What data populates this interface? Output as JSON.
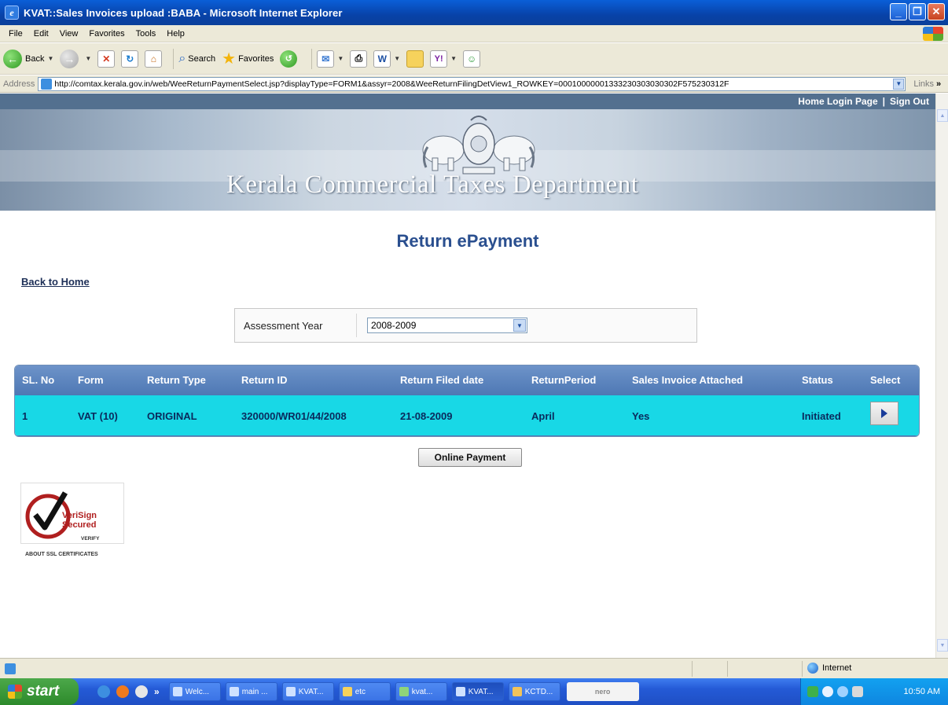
{
  "window": {
    "title": "KVAT::Sales Invoices upload :BABA - Microsoft Internet Explorer"
  },
  "menu": {
    "items": [
      "File",
      "Edit",
      "View",
      "Favorites",
      "Tools",
      "Help"
    ]
  },
  "toolbar": {
    "back_label": "Back",
    "search_label": "Search",
    "favorites_label": "Favorites"
  },
  "address": {
    "label": "Address",
    "url": "http://comtax.kerala.gov.in/web/WeeReturnPaymentSelect.jsp?displayType=FORM1&assyr=2008&WeeReturnFilingDetView1_ROWKEY=00010000001333230303030302F575230312F",
    "links_label": "Links"
  },
  "header": {
    "home_login": "Home Login Page",
    "divider": "|",
    "sign_out": "Sign Out",
    "department_title": "Kerala Commercial Taxes Department"
  },
  "main": {
    "page_title": "Return ePayment",
    "back_link": "Back to Home",
    "assessment_year_label": "Assessment Year",
    "assessment_year_value": "2008-2009",
    "online_payment_label": "Online Payment"
  },
  "table": {
    "columns": [
      "SL. No",
      "Form",
      "Return Type",
      "Return ID",
      "Return Filed date",
      "ReturnPeriod",
      "Sales Invoice Attached",
      "Status",
      "Select"
    ],
    "rows": [
      {
        "sl_no": "1",
        "form": "VAT (10)",
        "return_type": "ORIGINAL",
        "return_id": "320000/WR01/44/2008",
        "filed_date": "21-08-2009",
        "period": "April",
        "sales_invoice": "Yes",
        "status": "Initiated"
      }
    ]
  },
  "seal": {
    "line1": "VeriSign",
    "line2": "Secured",
    "verify": "VERIFY",
    "about": "ABOUT SSL CERTIFICATES"
  },
  "statusbar": {
    "zone": "Internet"
  },
  "taskbar": {
    "start_label": "start",
    "tasks": [
      "Welc...",
      "main ...",
      "KVAT...",
      "etc",
      "kvat...",
      "KVAT...",
      "KCTD..."
    ],
    "nero_label": "nero",
    "clock": "10:50 AM"
  },
  "colors": {
    "row_highlight": "#18d8e6",
    "header_bg": "#4e78b4",
    "title_blue": "#2a4f8f"
  }
}
